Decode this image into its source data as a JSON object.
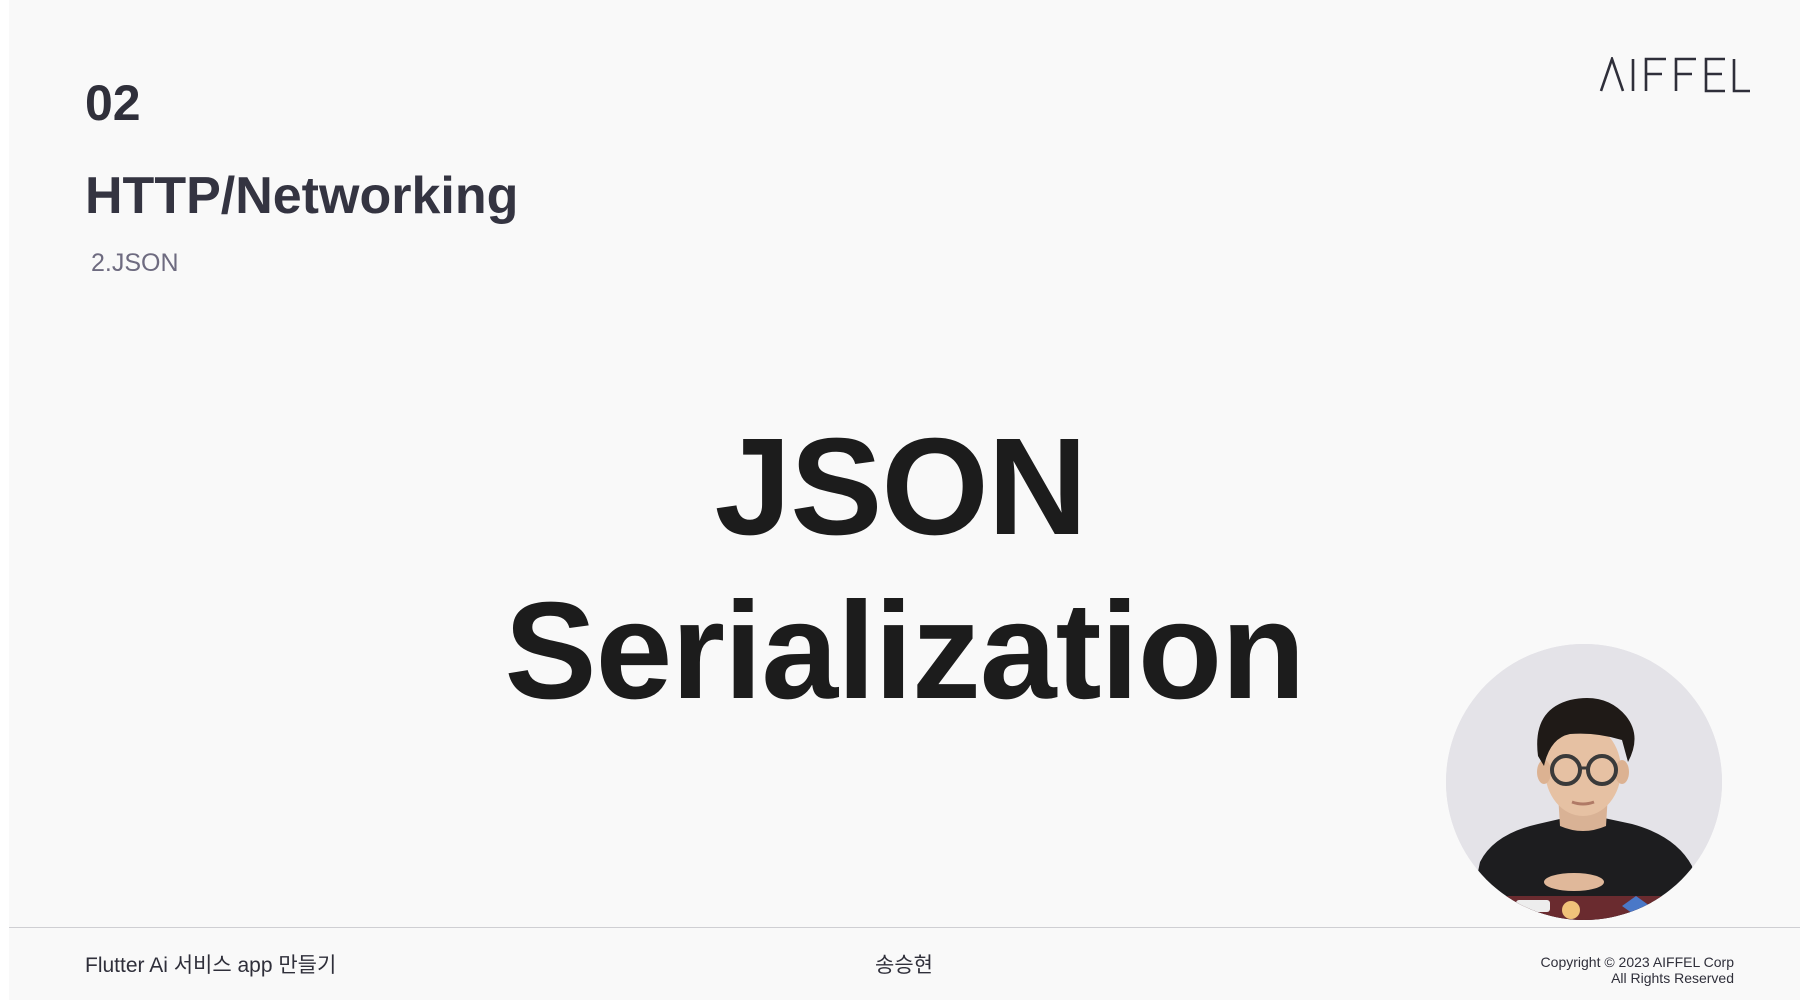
{
  "slide": {
    "section_number": "02",
    "section_title": "HTTP/Networking",
    "section_subtitle": "2.JSON",
    "brand": "AIFFEL",
    "headline_line1": "JSON",
    "headline_line2": "Serialization"
  },
  "presenter": {
    "image": "presenter-webcam-circle"
  },
  "footer": {
    "course_title": "Flutter Ai 서비스 app 만들기",
    "presenter_name": "송승현",
    "copyright_line1": "Copyright © 2023 AIFFEL Corp",
    "copyright_line2": "All Rights Reserved"
  },
  "colors": {
    "background": "#f9f9f9",
    "heading": "#2f2f3a",
    "subtitle": "#6e6b80",
    "headline": "#1c1c1c"
  }
}
